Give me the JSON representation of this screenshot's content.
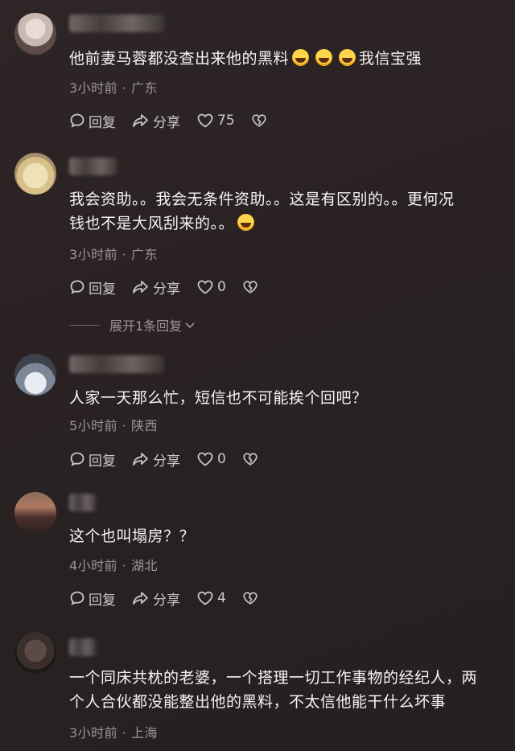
{
  "comments": [
    {
      "text": "他前妻马蓉都没查出来他的黑料",
      "emojis_after": 3,
      "text_suffix": "我信宝强",
      "meta": "3小时前 · 广东",
      "reply_label": "回复",
      "share_label": "分享",
      "likes": "75"
    },
    {
      "text_line1": "我会资助。。我会无条件资助。。这是有区别的。。更何况",
      "text_line2": "钱也不是大风刮来的。。",
      "meta": "3小时前 · 广东",
      "reply_label": "回复",
      "share_label": "分享",
      "likes": "0",
      "expand_replies": "展开1条回复"
    },
    {
      "text": "人家一天那么忙，短信也不可能挨个回吧？",
      "meta": "5小时前 · 陕西",
      "reply_label": "回复",
      "share_label": "分享",
      "likes": "0"
    },
    {
      "text": "这个也叫塌房？？",
      "meta": "4小时前 · 湖北",
      "reply_label": "回复",
      "share_label": "分享",
      "likes": "4"
    },
    {
      "text_line1": "一个同床共枕的老婆，一个搭理一切工作事物的经纪人，两",
      "text_line2": "个人合伙都没能整出他的黑料，不太信他能干什么坏事",
      "meta": "3小时前 · 上海"
    }
  ],
  "icons": {
    "reply": "comment-bubble-icon",
    "share": "share-arrow-icon",
    "like": "heart-icon",
    "dislike": "broken-heart-icon",
    "emoji": "laughing-tears-emoji-icon"
  }
}
